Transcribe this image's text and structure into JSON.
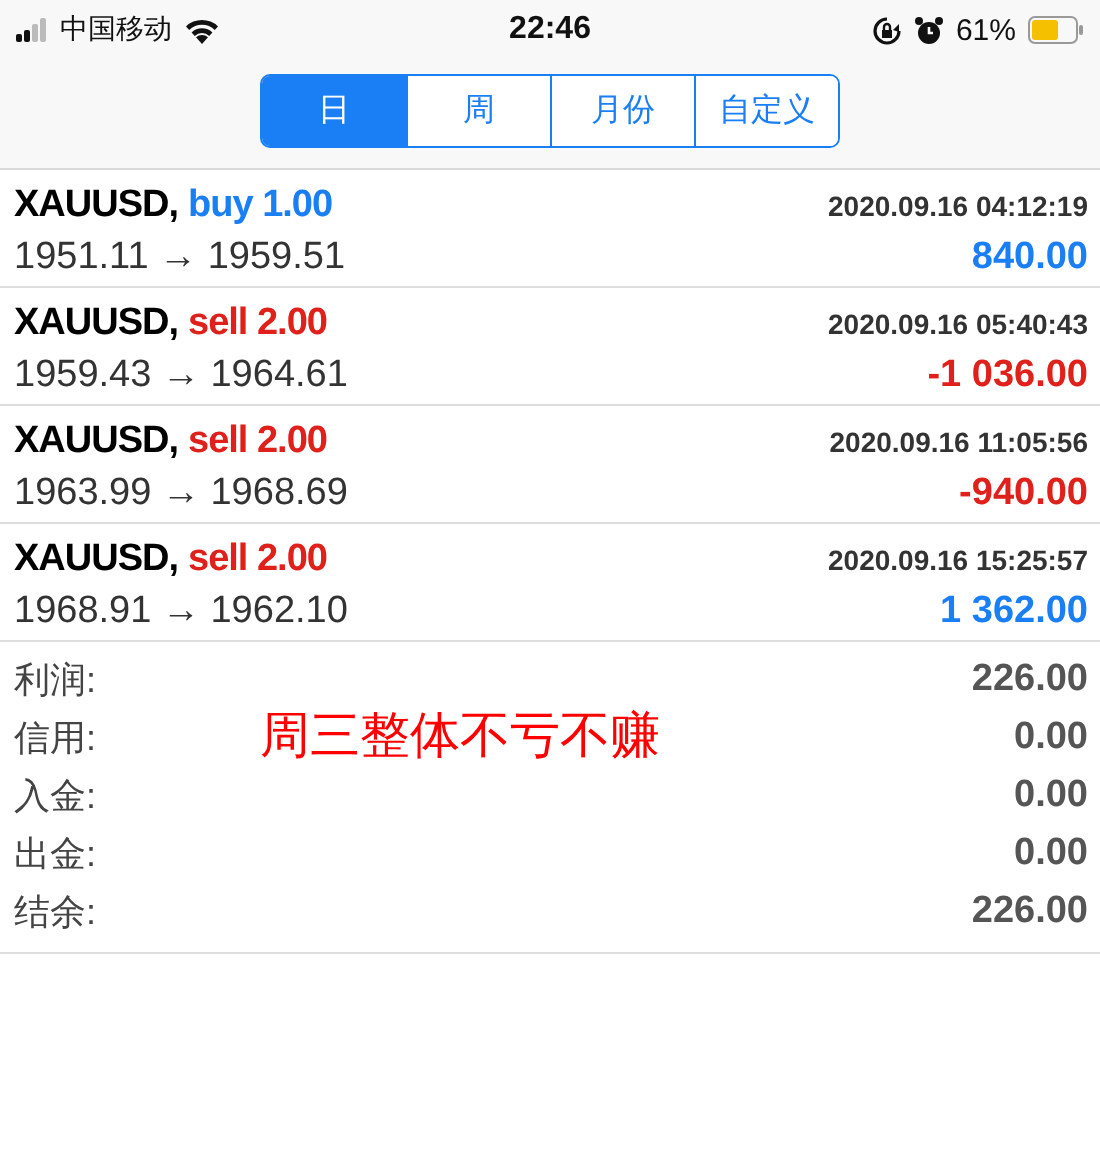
{
  "status_bar": {
    "carrier": "中国移动",
    "time": "22:46",
    "battery": "61%"
  },
  "tabs": [
    {
      "label": "日",
      "selected": true
    },
    {
      "label": "周",
      "selected": false
    },
    {
      "label": "月份",
      "selected": false
    },
    {
      "label": "自定义",
      "selected": false
    }
  ],
  "trades": [
    {
      "symbol": "XAUUSD,",
      "side": "buy 1.00",
      "kind": "buy",
      "time": "2020.09.16 04:12:19",
      "prices": "1951.11 → 1959.51",
      "profit": "840.00",
      "loss": false
    },
    {
      "symbol": "XAUUSD,",
      "side": "sell 2.00",
      "kind": "sell",
      "time": "2020.09.16 05:40:43",
      "prices": "1959.43 → 1964.61",
      "profit": "-1 036.00",
      "loss": true
    },
    {
      "symbol": "XAUUSD,",
      "side": "sell 2.00",
      "kind": "sell",
      "time": "2020.09.16 11:05:56",
      "prices": "1963.99 → 1968.69",
      "profit": "-940.00",
      "loss": true
    },
    {
      "symbol": "XAUUSD,",
      "side": "sell 2.00",
      "kind": "sell",
      "time": "2020.09.16 15:25:57",
      "prices": "1968.91 → 1962.10",
      "profit": "1 362.00",
      "loss": false
    }
  ],
  "summary": [
    {
      "label": "利润:",
      "value": "226.00"
    },
    {
      "label": "信用:",
      "value": "0.00"
    },
    {
      "label": "入金:",
      "value": "0.00"
    },
    {
      "label": "出金:",
      "value": "0.00"
    },
    {
      "label": "结余:",
      "value": "226.00"
    }
  ],
  "annotation": "周三整体不亏不赚"
}
